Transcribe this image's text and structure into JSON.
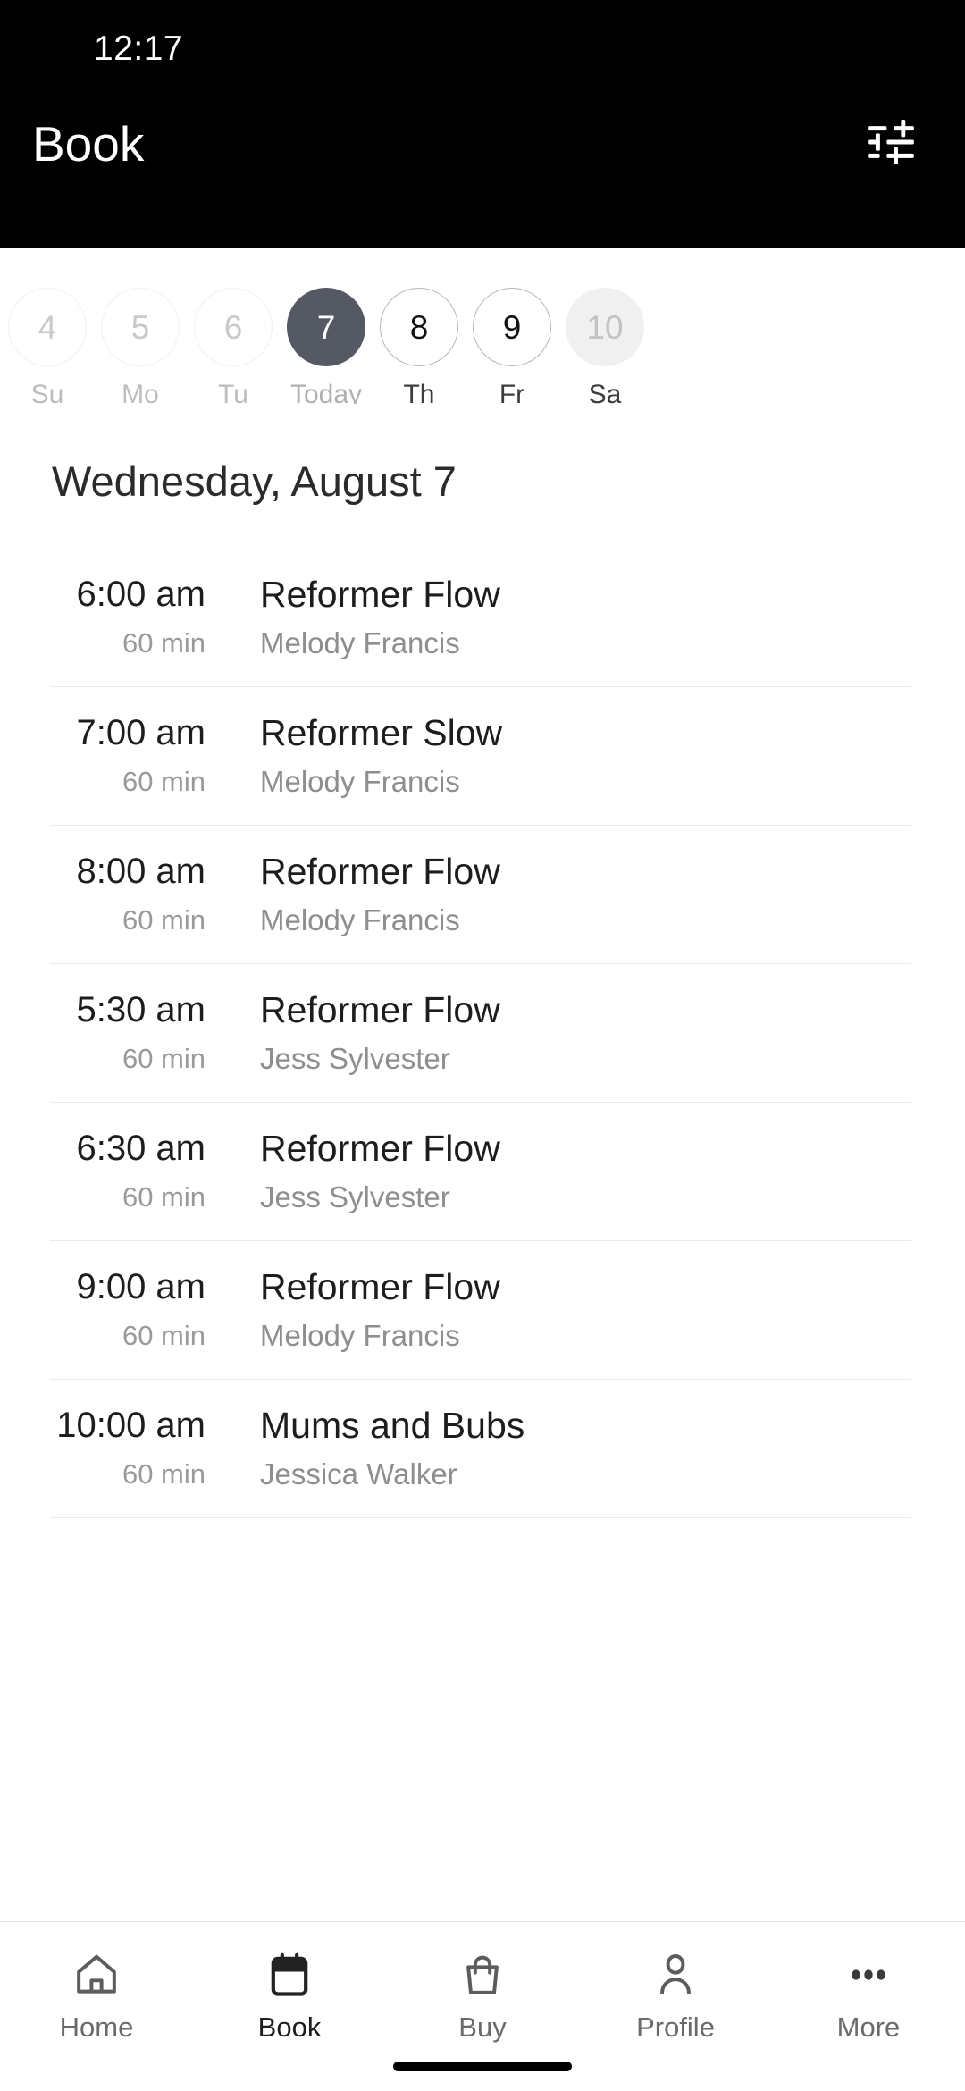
{
  "status_bar": {
    "time": "12:17"
  },
  "appbar": {
    "title": "Book",
    "filter_icon": "tune-sliders-icon"
  },
  "date_strip": {
    "days": [
      {
        "number": "4",
        "label": "Su",
        "state": "past"
      },
      {
        "number": "5",
        "label": "Mo",
        "state": "past"
      },
      {
        "number": "6",
        "label": "Tu",
        "state": "past"
      },
      {
        "number": "7",
        "label": "Today",
        "state": "selected"
      },
      {
        "number": "8",
        "label": "Th",
        "state": "available"
      },
      {
        "number": "9",
        "label": "Fr",
        "state": "available"
      },
      {
        "number": "10",
        "label": "Sa",
        "state": "faded"
      }
    ]
  },
  "day_heading": "Wednesday, August 7",
  "classes": [
    {
      "time": "6:00 am",
      "duration": "60 min",
      "name": "Reformer Flow",
      "instructor": "Melody Francis"
    },
    {
      "time": "7:00 am",
      "duration": "60 min",
      "name": "Reformer Slow",
      "instructor": "Melody Francis"
    },
    {
      "time": "8:00 am",
      "duration": "60 min",
      "name": "Reformer Flow",
      "instructor": "Melody Francis"
    },
    {
      "time": "5:30 am",
      "duration": "60 min",
      "name": "Reformer Flow",
      "instructor": "Jess Sylvester"
    },
    {
      "time": "6:30 am",
      "duration": "60 min",
      "name": "Reformer Flow",
      "instructor": "Jess Sylvester"
    },
    {
      "time": "9:00 am",
      "duration": "60 min",
      "name": "Reformer Flow",
      "instructor": "Melody Francis"
    },
    {
      "time": "10:00 am",
      "duration": "60 min",
      "name": "Mums and Bubs",
      "instructor": "Jessica Walker"
    }
  ],
  "bottom_nav": {
    "items": [
      {
        "label": "Home",
        "icon": "home-icon",
        "active": false
      },
      {
        "label": "Book",
        "icon": "calendar-icon",
        "active": true
      },
      {
        "label": "Buy",
        "icon": "bag-icon",
        "active": false
      },
      {
        "label": "Profile",
        "icon": "person-icon",
        "active": false
      },
      {
        "label": "More",
        "icon": "ellipsis-icon",
        "active": false
      }
    ]
  },
  "colors": {
    "header_bg": "#000000",
    "selected_day": "#545963",
    "text_primary": "#1d1d1d",
    "text_muted": "#8e8e8e",
    "divider": "#eaeaea"
  }
}
